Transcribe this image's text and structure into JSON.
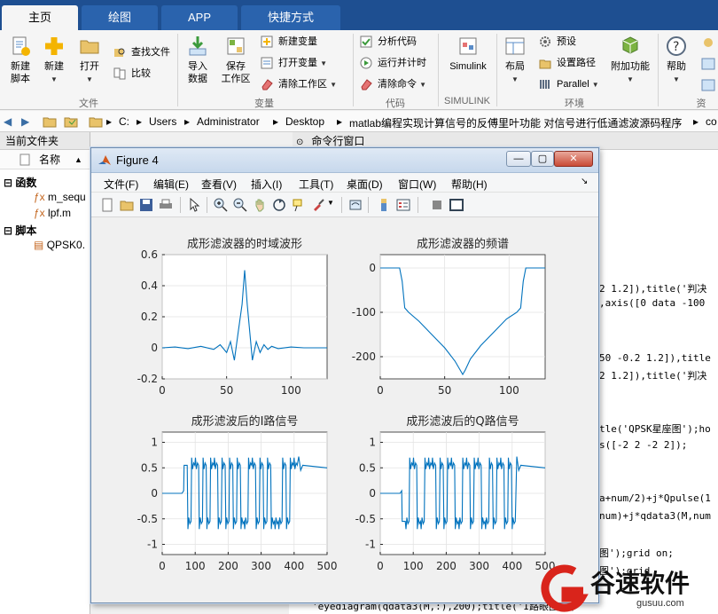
{
  "tabs": [
    {
      "label": "主页",
      "active": true
    },
    {
      "label": "绘图",
      "active": false
    },
    {
      "label": "APP",
      "active": false
    },
    {
      "label": "快捷方式",
      "active": false
    }
  ],
  "ribbon": {
    "file": {
      "new_script": "新建\n脚本",
      "new": "新建",
      "open": "打开",
      "find_files": "查找文件",
      "compare": "比较",
      "group": "文件"
    },
    "variable": {
      "import": "导入\n数据",
      "save_ws": "保存\n工作区",
      "new_var": "新建变量",
      "open_var": "打开变量",
      "clear_ws": "清除工作区",
      "group": "变量"
    },
    "code": {
      "analyze": "分析代码",
      "run_time": "运行并计时",
      "clear_cmd": "清除命令",
      "group": "代码"
    },
    "simulink": {
      "label": "Simulink",
      "group": "SIMULINK"
    },
    "env": {
      "layout": "布局",
      "prefs": "预设",
      "set_path": "设置路径",
      "parallel": "Parallel",
      "addons": "附加功能",
      "group": "环境"
    },
    "help": {
      "label": "帮助",
      "group": "资"
    }
  },
  "address": {
    "parts": [
      "C:",
      "Users",
      "Administrator",
      "Desktop",
      "matlab编程实现计算信号的反傅里叶功能 对信号进行低通滤波源码程序",
      "co"
    ]
  },
  "left_panel": {
    "title": "当前文件夹",
    "col_name": "名称",
    "sort": "▲",
    "groups": [
      {
        "label": "函数",
        "files": [
          "m_sequ",
          "lpf.m"
        ]
      },
      {
        "label": "脚本",
        "files": [
          "QPSK0."
        ]
      }
    ]
  },
  "command_window": {
    "title": "命令行窗口",
    "lines": [
      "2 1.2]),title('判决",
      ",axis([0 data -100",
      "50 -0.2 1.2]),title",
      "2 1.2]),title('判决",
      "tle('QPSK星座图');ho",
      "s([-2 2 -2 2]);",
      "a+num/2)+j*Qpulse(1",
      "num)+j*qdata3(M,num",
      "图');grid on;",
      "图');grid",
      "'eyediagram(qdata3(M,:),200);title('I路眼图');"
    ]
  },
  "figure": {
    "title": "Figure 4",
    "menus": [
      "文件(F)",
      "编辑(E)",
      "查看(V)",
      "插入(I)",
      "工具(T)",
      "桌面(D)",
      "窗口(W)",
      "帮助(H)"
    ],
    "window_buttons": [
      "—",
      "▢",
      "✕"
    ]
  },
  "chart_data": [
    {
      "type": "line",
      "title": "成形滤波器的时域波形",
      "xlim": [
        0,
        128
      ],
      "ylim": [
        -0.2,
        0.6
      ],
      "xticks": [
        0,
        50,
        100
      ],
      "yticks": [
        -0.2,
        0,
        0.2,
        0.4,
        0.6
      ],
      "x": [
        0,
        10,
        20,
        30,
        40,
        45,
        50,
        53,
        56,
        59,
        62,
        64,
        66,
        68,
        70,
        73,
        76,
        79,
        82,
        85,
        90,
        100,
        110,
        128
      ],
      "y": [
        0,
        0.005,
        -0.005,
        0.01,
        -0.01,
        0.02,
        -0.03,
        0.04,
        -0.08,
        0.1,
        0.28,
        0.5,
        0.28,
        0.1,
        -0.08,
        0.04,
        -0.03,
        0.02,
        -0.01,
        0.01,
        -0.005,
        0.005,
        0,
        0
      ]
    },
    {
      "type": "line",
      "title": "成形滤波器的频谱",
      "xlim": [
        0,
        128
      ],
      "ylim": [
        -250,
        30
      ],
      "xticks": [
        0,
        50,
        100
      ],
      "yticks": [
        0,
        -100,
        -200
      ],
      "x": [
        0,
        15,
        17,
        19,
        22,
        30,
        40,
        50,
        58,
        62,
        64,
        66,
        70,
        78,
        88,
        98,
        106,
        109,
        111,
        113,
        128
      ],
      "y": [
        0,
        0,
        -30,
        -90,
        -100,
        -120,
        -150,
        -180,
        -210,
        -230,
        -240,
        -230,
        -205,
        -175,
        -145,
        -115,
        -100,
        -90,
        -30,
        0,
        0
      ]
    },
    {
      "type": "line",
      "title": "成形滤波后的I路信号",
      "xlim": [
        0,
        500
      ],
      "ylim": [
        -1.2,
        1.2
      ],
      "xticks": [
        0,
        100,
        200,
        300,
        400,
        500
      ],
      "yticks": [
        -1,
        -0.5,
        0,
        0.5,
        1
      ],
      "bits": [
        1,
        -1,
        1,
        1,
        -1,
        1,
        -1,
        1,
        1,
        -1,
        1,
        -1,
        1,
        -1,
        1,
        -1,
        -1,
        1,
        1,
        -1,
        1,
        -1,
        1,
        -1,
        -1,
        -1,
        1,
        -1,
        1,
        1
      ],
      "x_start": 65,
      "x_end": 410
    },
    {
      "type": "line",
      "title": "成形滤波后的Q路信号",
      "xlim": [
        0,
        500
      ],
      "ylim": [
        -1.2,
        1.2
      ],
      "xticks": [
        0,
        100,
        200,
        300,
        400,
        500
      ],
      "yticks": [
        -1,
        -0.5,
        0,
        0.5,
        1
      ],
      "bits": [
        -1,
        -1,
        1,
        1,
        -1,
        -1,
        1,
        1,
        1,
        -1,
        1,
        -1,
        1,
        1,
        -1,
        -1,
        1,
        1,
        -1,
        1,
        1,
        -1,
        -1,
        1,
        -1,
        1,
        1,
        -1,
        1,
        -1
      ],
      "x_start": 65,
      "x_end": 410
    }
  ],
  "watermark": {
    "text": "谷速软件",
    "sub": "gusuu.com"
  },
  "colors": {
    "line": "#0072bd",
    "tabbar": "#1e4f91"
  }
}
